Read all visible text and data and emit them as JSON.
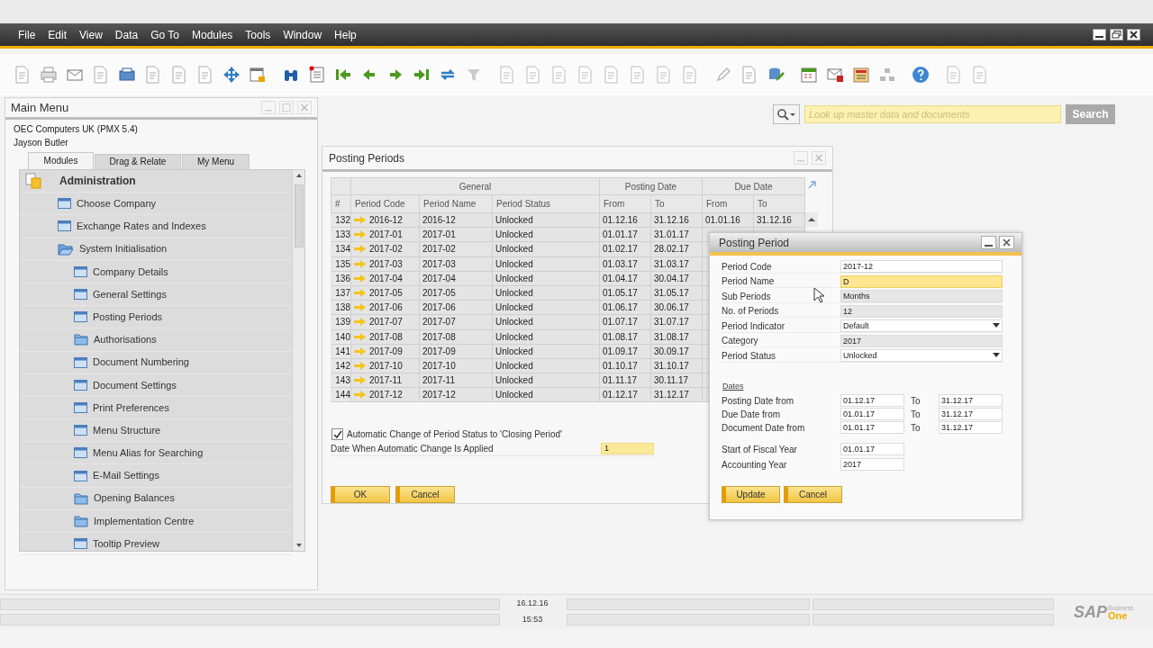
{
  "menu_bar": [
    "File",
    "Edit",
    "View",
    "Data",
    "Go To",
    "Modules",
    "Tools",
    "Window",
    "Help"
  ],
  "search": {
    "placeholder": "Look up master data and documents",
    "button": "Search"
  },
  "main_menu": {
    "title": "Main Menu",
    "company": "OEC Computers UK (PMX 5.4)",
    "user": "Jayson Butler",
    "tabs": [
      {
        "label": "Modules",
        "selected": true
      },
      {
        "label": "Drag & Relate",
        "selected": false
      },
      {
        "label": "My Menu",
        "selected": false
      }
    ],
    "tree": [
      {
        "label": "Administration",
        "kind": "module",
        "children": [
          {
            "label": "Choose Company",
            "kind": "form"
          },
          {
            "label": "Exchange Rates and Indexes",
            "kind": "form"
          },
          {
            "label": "System Initialisation",
            "kind": "folder",
            "expanded": true,
            "children": [
              {
                "label": "Company Details",
                "kind": "form"
              },
              {
                "label": "General Settings",
                "kind": "form"
              },
              {
                "label": "Posting Periods",
                "kind": "form"
              },
              {
                "label": "Authorisations",
                "kind": "folder",
                "expanded": false
              },
              {
                "label": "Document Numbering",
                "kind": "form"
              },
              {
                "label": "Document Settings",
                "kind": "form"
              },
              {
                "label": "Print Preferences",
                "kind": "form"
              },
              {
                "label": "Menu Structure",
                "kind": "form"
              },
              {
                "label": "Menu Alias for Searching",
                "kind": "form"
              },
              {
                "label": "E-Mail Settings",
                "kind": "form"
              },
              {
                "label": "Opening Balances",
                "kind": "folder",
                "expanded": false
              },
              {
                "label": "Implementation Centre",
                "kind": "folder",
                "expanded": false
              },
              {
                "label": "Tooltip Preview",
                "kind": "form"
              }
            ]
          }
        ]
      }
    ]
  },
  "posting_periods": {
    "title": "Posting Periods",
    "column_groups": [
      "General",
      "Posting Date",
      "Due Date"
    ],
    "columns": [
      "#",
      "Period Code",
      "Period Name",
      "Period Status",
      "From",
      "To",
      "From",
      "To"
    ],
    "rows": [
      {
        "num": "132",
        "code": "2016-12",
        "name": "2016-12",
        "status": "Unlocked",
        "post_from": "01.12.16",
        "post_to": "31.12.16",
        "due_from": "01.01.16",
        "due_to": "31.12.16"
      },
      {
        "num": "133",
        "code": "2017-01",
        "name": "2017-01",
        "status": "Unlocked",
        "post_from": "01.01.17",
        "post_to": "31.01.17"
      },
      {
        "num": "134",
        "code": "2017-02",
        "name": "2017-02",
        "status": "Unlocked",
        "post_from": "01.02.17",
        "post_to": "28.02.17"
      },
      {
        "num": "135",
        "code": "2017-03",
        "name": "2017-03",
        "status": "Unlocked",
        "post_from": "01.03.17",
        "post_to": "31.03.17"
      },
      {
        "num": "136",
        "code": "2017-04",
        "name": "2017-04",
        "status": "Unlocked",
        "post_from": "01.04.17",
        "post_to": "30.04.17"
      },
      {
        "num": "137",
        "code": "2017-05",
        "name": "2017-05",
        "status": "Unlocked",
        "post_from": "01.05.17",
        "post_to": "31.05.17"
      },
      {
        "num": "138",
        "code": "2017-06",
        "name": "2017-06",
        "status": "Unlocked",
        "post_from": "01.06.17",
        "post_to": "30.06.17"
      },
      {
        "num": "139",
        "code": "2017-07",
        "name": "2017-07",
        "status": "Unlocked",
        "post_from": "01.07.17",
        "post_to": "31.07.17"
      },
      {
        "num": "140",
        "code": "2017-08",
        "name": "2017-08",
        "status": "Unlocked",
        "post_from": "01.08.17",
        "post_to": "31.08.17"
      },
      {
        "num": "141",
        "code": "2017-09",
        "name": "2017-09",
        "status": "Unlocked",
        "post_from": "01.09.17",
        "post_to": "30.09.17"
      },
      {
        "num": "142",
        "code": "2017-10",
        "name": "2017-10",
        "status": "Unlocked",
        "post_from": "01.10.17",
        "post_to": "31.10.17"
      },
      {
        "num": "143",
        "code": "2017-11",
        "name": "2017-11",
        "status": "Unlocked",
        "post_from": "01.11.17",
        "post_to": "30.11.17"
      },
      {
        "num": "144",
        "code": "2017-12",
        "name": "2017-12",
        "status": "Unlocked",
        "post_from": "01.12.17",
        "post_to": "31.12.17"
      }
    ],
    "auto_change": {
      "label": "Automatic Change of Period Status to 'Closing Period'",
      "checked": true
    },
    "date_applied": {
      "label": "Date When Automatic Change Is Applied",
      "value": "1"
    },
    "buttons": [
      "OK",
      "Cancel"
    ]
  },
  "posting_period_dialog": {
    "title": "Posting Period",
    "fields": [
      {
        "label": "Period Code",
        "value": "2017-12",
        "kind": "text"
      },
      {
        "label": "Period Name",
        "value": "D",
        "kind": "active"
      },
      {
        "label": "Sub Periods",
        "value": "Months",
        "kind": "readonly"
      },
      {
        "label": "No. of Periods",
        "value": "12",
        "kind": "readonly"
      },
      {
        "label": "Period Indicator",
        "value": "Default",
        "kind": "select"
      },
      {
        "label": "Category",
        "value": "2017",
        "kind": "readonly"
      },
      {
        "label": "Period Status",
        "value": "Unlocked",
        "kind": "select"
      }
    ],
    "dates_heading": "Dates",
    "date_rows": [
      {
        "label": "Posting Date from",
        "from": "01.12.17",
        "to_label": "To",
        "to": "31.12.17"
      },
      {
        "label": "Due Date from",
        "from": "01.01.17",
        "to_label": "To",
        "to": "31.12.17"
      },
      {
        "label": "Document Date from",
        "from": "01.01.17",
        "to_label": "To",
        "to": "31.12.17"
      }
    ],
    "year_fields": [
      {
        "label": "Start of Fiscal Year",
        "value": "01.01.17"
      },
      {
        "label": "Accounting Year",
        "value": "2017"
      }
    ],
    "buttons": [
      "Update",
      "Cancel"
    ]
  },
  "status_bar": {
    "date": "16.12.16",
    "time": "15:53"
  },
  "logo": {
    "brand": "SAP",
    "line1": "Business",
    "line2": "One"
  }
}
